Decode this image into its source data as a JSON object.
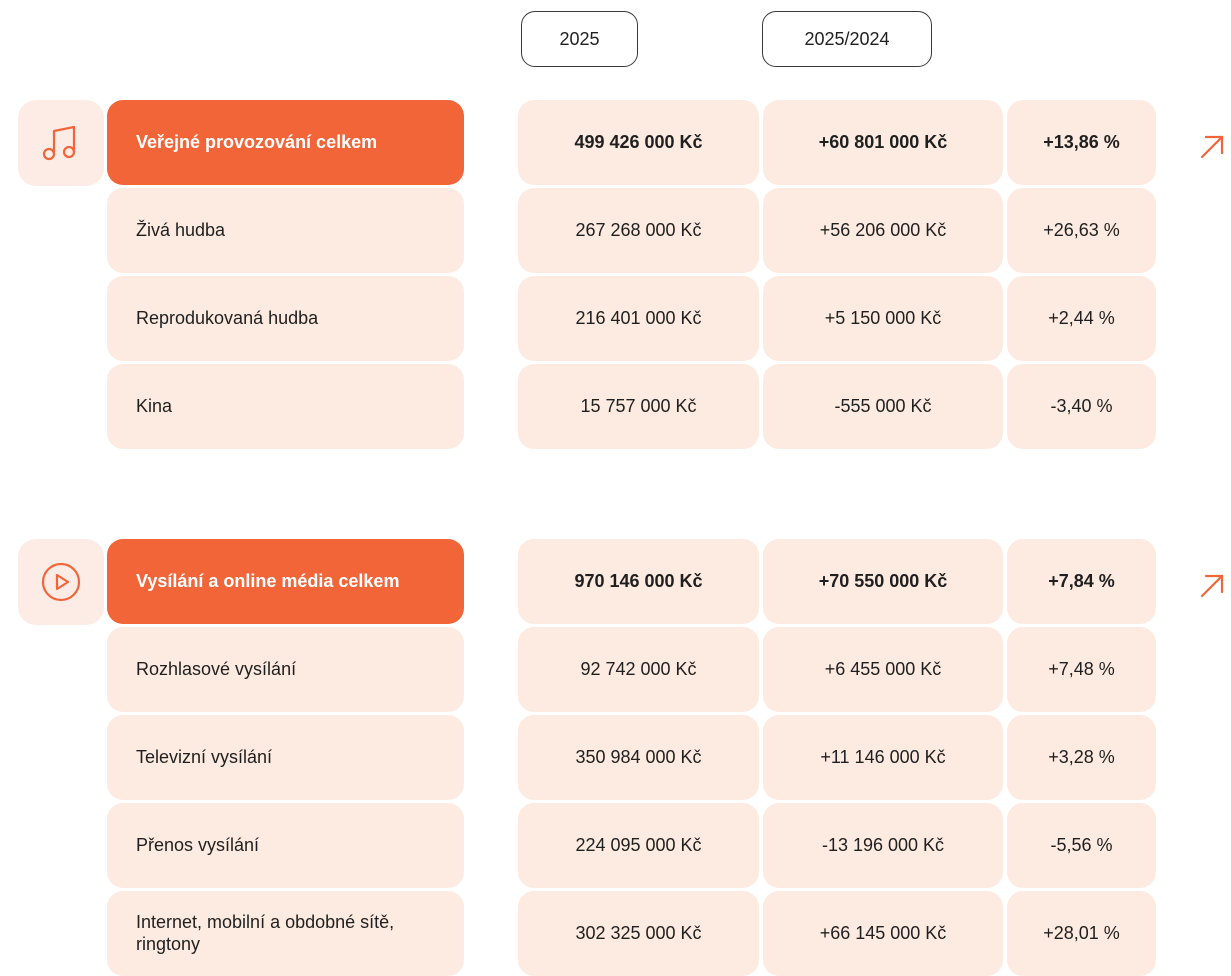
{
  "header": {
    "col_year": "2025",
    "col_diff": "2025/2024"
  },
  "sections": [
    {
      "icon": "music-note-icon",
      "total": {
        "label": "Veřejné provozování celkem",
        "value": "499 426 000 Kč",
        "diff": "+60 801 000 Kč",
        "pct": "+13,86 %"
      },
      "rows": [
        {
          "label": "Živá hudba",
          "value": "267 268 000 Kč",
          "diff": "+56 206 000 Kč",
          "pct": "+26,63 %"
        },
        {
          "label": "Reprodukovaná hudba",
          "value": "216 401 000 Kč",
          "diff": "+5 150 000 Kč",
          "pct": "+2,44 %"
        },
        {
          "label": "Kina",
          "value": "15 757 000 Kč",
          "diff": "-555 000 Kč",
          "pct": "-3,40 %"
        }
      ]
    },
    {
      "icon": "play-circle-icon",
      "total": {
        "label": "Vysílání a online média celkem",
        "value": "970 146 000 Kč",
        "diff": "+70 550 000 Kč",
        "pct": "+7,84 %"
      },
      "rows": [
        {
          "label": "Rozhlasové vysílání",
          "value": "92 742 000 Kč",
          "diff": "+6 455 000 Kč",
          "pct": "+7,48 %"
        },
        {
          "label": "Televizní vysílání",
          "value": "350 984 000 Kč",
          "diff": "+11 146 000 Kč",
          "pct": "+3,28 %"
        },
        {
          "label": "Přenos vysílání",
          "value": "224 095 000 Kč",
          "diff": "-13 196 000 Kč",
          "pct": "-5,56 %"
        },
        {
          "label": "Internet, mobilní a obdobné sítě, ringtony",
          "value": "302 325 000 Kč",
          "diff": "+66 145 000 Kč",
          "pct": "+28,01 %"
        }
      ]
    }
  ],
  "colors": {
    "accent": "#f26539",
    "cell_bg": "#fdebe1"
  },
  "trend_icon": "arrow-up-right-icon"
}
